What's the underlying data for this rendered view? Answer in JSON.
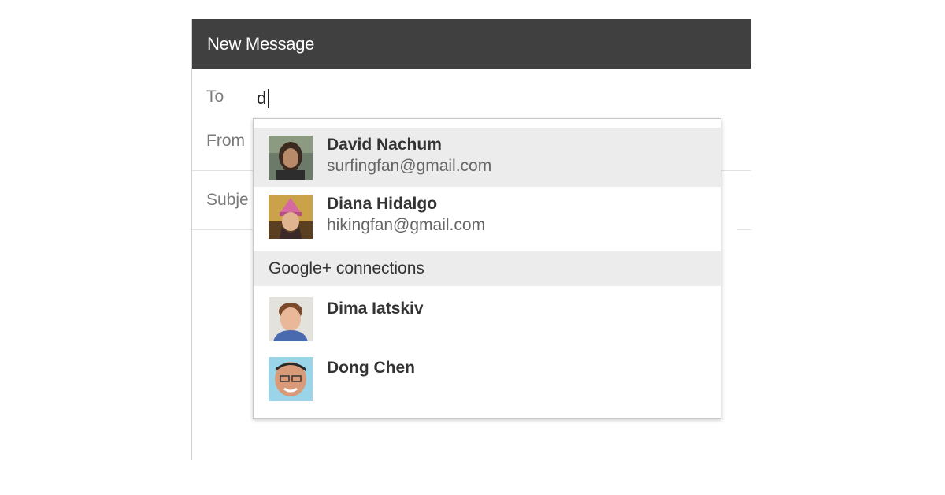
{
  "compose": {
    "title": "New Message",
    "to_label": "To",
    "to_value": "d",
    "from_label": "From",
    "subject_label": "Subje"
  },
  "autocomplete": {
    "contacts": [
      {
        "name": "David Nachum",
        "email": "surfingfan@gmail.com",
        "avatar": "person-avatar",
        "selected": true
      },
      {
        "name": "Diana Hidalgo",
        "email": "hikingfan@gmail.com",
        "avatar": "person-avatar",
        "selected": false
      }
    ],
    "section_label": "Google+ connections",
    "connections": [
      {
        "name": "Dima Iatskiv",
        "avatar": "person-avatar"
      },
      {
        "name": "Dong Chen",
        "avatar": "person-avatar"
      }
    ]
  },
  "colors": {
    "header_bg": "#404040",
    "selected_row_bg": "#ececec",
    "section_bg": "#ececec"
  }
}
